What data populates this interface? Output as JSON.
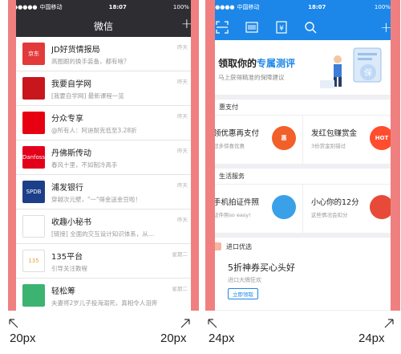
{
  "wechat": {
    "status": {
      "carrier": "中国移动",
      "time": "18:07",
      "battery": "100%"
    },
    "header": {
      "title": "微信",
      "plus": "+"
    },
    "chats": [
      {
        "title": "JD好货情报局",
        "preview": "高图跟的换手装备，都有啥？",
        "time": "昨天",
        "avatar_text": "京东",
        "avatar_color": "#e23a3a"
      },
      {
        "title": "我要自学网",
        "preview": "[我要自学网] 最新课程一览",
        "time": "昨天",
        "avatar_text": "",
        "avatar_color": "#c8161d"
      },
      {
        "title": "分众专享",
        "preview": "@所有人：阿迪耐克低至3.28折",
        "time": "昨天",
        "avatar_text": "",
        "avatar_color": "#e60012"
      },
      {
        "title": "丹佛斯传动",
        "preview": "春风十里，不如制冷高手",
        "time": "昨天",
        "avatar_text": "Danfoss",
        "avatar_color": "#e2001a"
      },
      {
        "title": "浦发银行",
        "preview": "穿越次元壁，\"一\"得金送金豆啦！",
        "time": "昨天",
        "avatar_text": "SPDB",
        "avatar_color": "#1d3f8a"
      },
      {
        "title": "收趣小秘书",
        "preview": "[链接] 全面的交互设计知识体系，从…",
        "time": "昨天",
        "avatar_text": "",
        "avatar_color": "#ffffff"
      },
      {
        "title": "135平台",
        "preview": "引导关注教程",
        "time": "星期二",
        "avatar_text": "135",
        "avatar_color": "#ffffff"
      },
      {
        "title": "轻松筹",
        "preview": "夫妻将2岁儿子投海溺死，真相令人泪奔",
        "time": "星期二",
        "avatar_text": "",
        "avatar_color": "#3cb371"
      }
    ]
  },
  "alipay": {
    "status": {
      "carrier": "中国移动",
      "time": "18:07",
      "battery": "100%"
    },
    "toolbar": {
      "scan": "scan-icon",
      "pay": "barcode-icon",
      "wallet": "yuan-icon",
      "search": "search-icon",
      "plus": "+"
    },
    "promo": {
      "title_prefix": "领取你的",
      "title_highlight": "专属测评",
      "subtitle": "马上获得精准的保障建议",
      "art_text": "保"
    },
    "sections": [
      {
        "name": "惠支付",
        "cards": [
          {
            "title": "领优惠再支付",
            "subtitle": "超多惊喜优惠",
            "icon_text": "惠",
            "icon_color": "#f25f2a"
          },
          {
            "title": "发红包赚赏金",
            "subtitle": "3份赏金别错过",
            "icon_text": "HOT",
            "icon_color": "#ff4d2e"
          }
        ]
      },
      {
        "name": "生活服务",
        "cards": [
          {
            "title": "手机拍证件照",
            "subtitle": "证件照so easy!",
            "icon_text": "",
            "icon_color": "#3aa0e8"
          },
          {
            "title": "小心你的12分",
            "subtitle": "这些情况会扣分",
            "icon_text": "",
            "icon_color": "#e84a3a"
          }
        ]
      }
    ],
    "jinkou": {
      "head": "进口优选",
      "title": "5折神券买心头好",
      "subtitle": "进口大牌狂欢",
      "button": "立即领取"
    }
  },
  "annotations": {
    "left_margin": "20px",
    "right_margin": "24px"
  },
  "colors": {
    "margin_highlight": "#f08080",
    "wechat_dark": "#2e2e32",
    "alipay_blue": "#1c87e8"
  }
}
